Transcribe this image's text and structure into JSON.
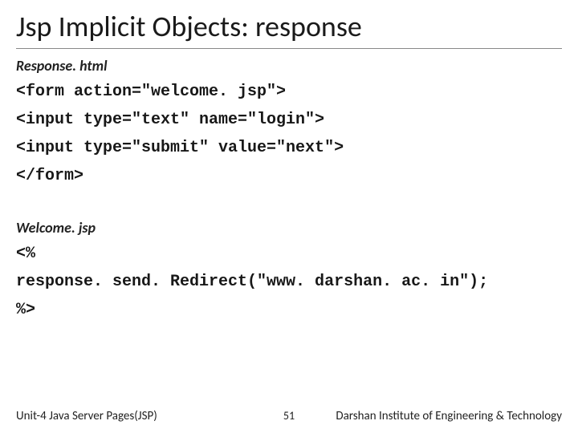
{
  "title": "Jsp Implicit Objects: response",
  "section1": {
    "heading": "Response. html",
    "code": "<form action=\"welcome. jsp\">\n<input type=\"text\" name=\"login\">\n<input type=\"submit\" value=\"next\">\n</form>"
  },
  "section2": {
    "heading": "Welcome. jsp",
    "code": "<%\nresponse. send. Redirect(\"www. darshan. ac. in\");\n%>"
  },
  "footer": {
    "left": "Unit-4 Java Server Pages(JSP)",
    "page": "51",
    "right": "Darshan Institute of Engineering & Technology"
  }
}
